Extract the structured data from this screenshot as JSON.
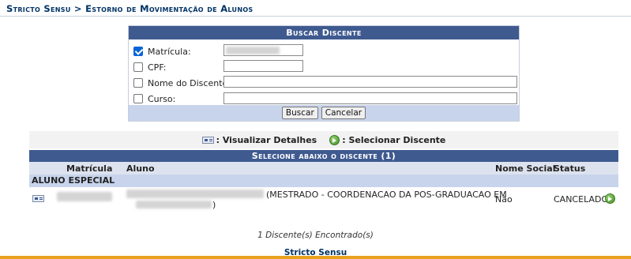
{
  "breadcrumb": "Stricto Sensu > Estorno de Movimentação de Alunos",
  "search": {
    "title": "Buscar Discente",
    "fields": [
      {
        "label": "Matrícula:",
        "checked": true
      },
      {
        "label": "CPF:",
        "checked": false
      },
      {
        "label": "Nome do Discente:",
        "checked": false
      },
      {
        "label": "Curso:",
        "checked": false
      }
    ],
    "buttons": {
      "search": "Buscar",
      "cancel": "Cancelar"
    }
  },
  "legend": {
    "view_details": ": Visualizar Detalhes",
    "select_student": ": Selecionar Discente"
  },
  "results": {
    "caption": "Selecione abaixo o discente (1)",
    "columns": {
      "matricula": "Matrícula",
      "aluno": "Aluno",
      "nome_social": "Nome Social",
      "status": "Status"
    },
    "groups": [
      {
        "name": "ALUNO ESPECIAL",
        "rows": [
          {
            "aluno_suffix": "(MESTRADO - COORDENACAO DA POS-GRADUACAO EM",
            "aluno_end": ")",
            "nome_social": "Não",
            "status": "CANCELADO"
          }
        ]
      }
    ]
  },
  "summary": "1 Discente(s) Encontrado(s)",
  "footer_link": "Stricto Sensu",
  "colors": {
    "header": "#3f5a8f",
    "accent_bar": "#e9a21d",
    "link": "#003366"
  }
}
